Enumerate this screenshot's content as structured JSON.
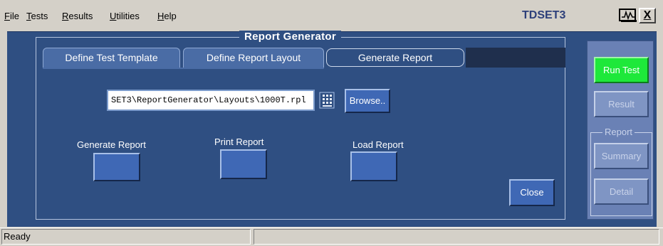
{
  "menu": {
    "items": [
      {
        "label": "File",
        "underline": "F",
        "rest": "ile"
      },
      {
        "label": "Tests",
        "underline": "T",
        "rest": "ests"
      },
      {
        "label": "Results",
        "underline": "R",
        "rest": "esults"
      },
      {
        "label": "Utilities",
        "underline": "U",
        "rest": "tilities"
      },
      {
        "label": "Help",
        "underline": "H",
        "rest": "elp"
      }
    ]
  },
  "app": {
    "title": "TDSET3",
    "close_label": "X",
    "window_icon": "oscilloscope-icon"
  },
  "panel": {
    "title": "Report Generator",
    "tabs": [
      {
        "label": "Define Test Template",
        "active": false
      },
      {
        "label": "Define Report Layout",
        "active": false
      },
      {
        "label": "Generate Report",
        "active": true
      }
    ],
    "path_value": "SET3\\ReportGenerator\\Layouts\\1000T.rpl",
    "keypad_icon": "keypad-icon",
    "browse_label": "Browse..",
    "generate_label": "Generate Report",
    "print_label": "Print Report",
    "load_label": "Load Report",
    "close_label": "Close"
  },
  "side": {
    "run_label": "Run Test",
    "result_label": "Result",
    "report_group_label": "Report",
    "summary_label": "Summary",
    "detail_label": "Detail"
  },
  "status": {
    "text": "Ready"
  },
  "colors": {
    "panel_bg": "#2f4f82",
    "button_blue": "#3f68b5",
    "run_green": "#1ee83a",
    "title_blue": "#2d3f7a"
  }
}
